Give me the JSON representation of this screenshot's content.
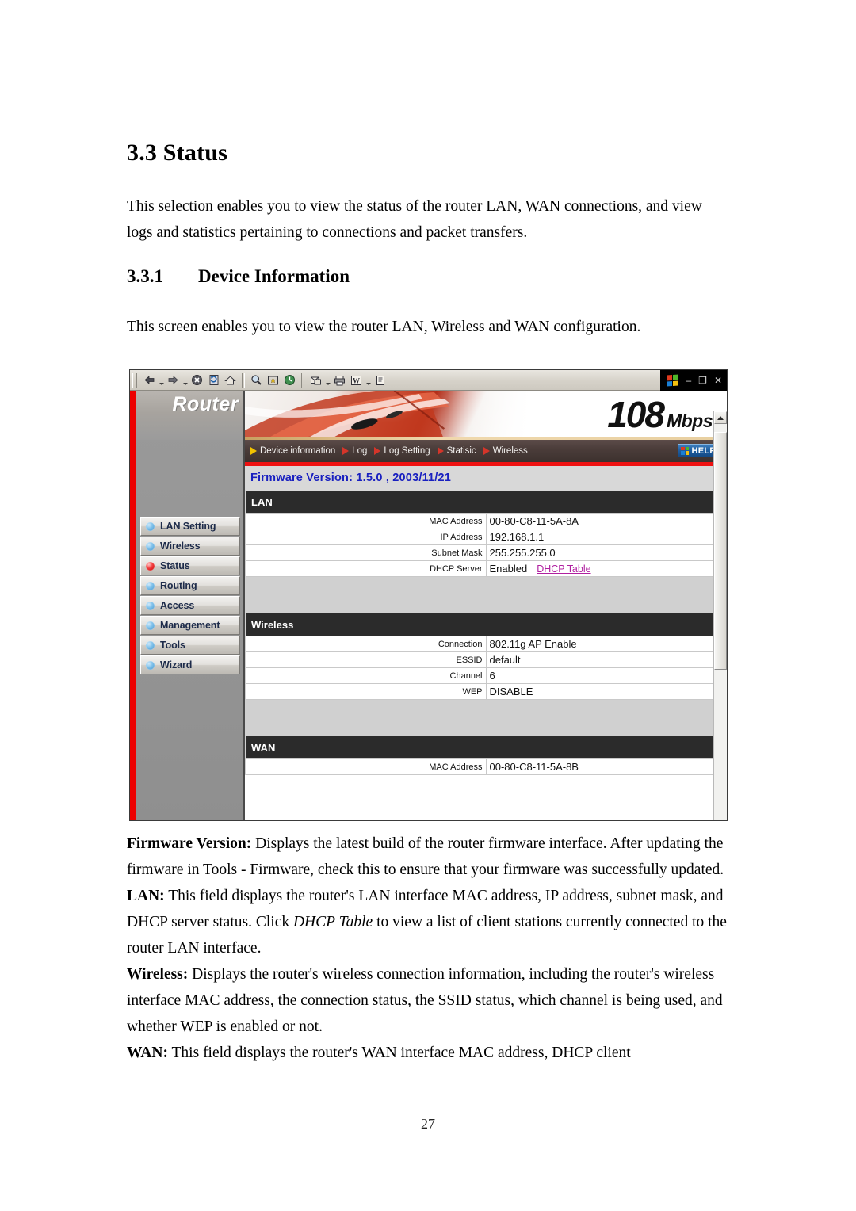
{
  "document": {
    "section_title": "3.3 Status",
    "intro_paragraph": "This selection enables you to view the status of the router LAN, WAN connections, and view logs and statistics pertaining to connections and packet transfers.",
    "subsection_number": "3.3.1",
    "subsection_title": "Device Information",
    "screen_intro": "This screen enables you to view the router LAN, Wireless and WAN configuration.",
    "page_number": "27",
    "descriptions": [
      {
        "label": "Firmware Version:",
        "text": " Displays the latest build of the router firmware interface. After updating the firmware in Tools - Firmware, check this to ensure that your firmware was successfully updated."
      },
      {
        "label": "LAN:",
        "text_before": " This field displays the router's LAN interface MAC address, IP address, subnet mask, and DHCP server status. Click ",
        "italic": "DHCP Table",
        "text_after": " to view a list of client stations currently connected to the router LAN interface."
      },
      {
        "label": "Wireless:",
        "text": " Displays the router's wireless connection information, including the router's wireless interface MAC address, the connection status, the SSID status, which channel is being used, and whether WEP is enabled or not."
      },
      {
        "label": "WAN:",
        "text": " This field displays the router's WAN interface MAC address, DHCP client"
      }
    ]
  },
  "browser": {
    "toolbar": {
      "buttons": [
        {
          "name": "back-button",
          "glyph": "⇐"
        },
        {
          "name": "forward-button",
          "glyph": "⇒"
        },
        {
          "name": "stop-button",
          "glyph": "⊗"
        },
        {
          "name": "refresh-button",
          "glyph": "↻"
        },
        {
          "name": "home-button",
          "glyph": "⌂"
        },
        {
          "name": "search-button",
          "glyph": "⌕"
        },
        {
          "name": "favorites-button",
          "glyph": "★"
        },
        {
          "name": "history-button",
          "glyph": "◔"
        },
        {
          "name": "mail-button",
          "glyph": "✉"
        },
        {
          "name": "print-button",
          "glyph": "⎙"
        },
        {
          "name": "edit-button",
          "glyph": "W"
        },
        {
          "name": "discuss-button",
          "glyph": "☰"
        }
      ]
    },
    "window_controls": {
      "minimize": "–",
      "restore": "❐",
      "close": "✕"
    }
  },
  "router_ui": {
    "logo": "Router",
    "banner": {
      "speed": "108",
      "unit": "Mbps"
    },
    "nav_items": [
      {
        "label": "Device information",
        "active": true
      },
      {
        "label": "Log",
        "active": false
      },
      {
        "label": "Log Setting",
        "active": false
      },
      {
        "label": "Statisic",
        "active": false
      },
      {
        "label": "Wireless",
        "active": false
      }
    ],
    "help_button": "HELP",
    "firmware_line": "Firmware Version: 1.5.0 , 2003/11/21",
    "sidebar_items": [
      {
        "label": "LAN Setting",
        "active": false
      },
      {
        "label": "Wireless",
        "active": false
      },
      {
        "label": "Status",
        "active": true
      },
      {
        "label": "Routing",
        "active": false
      },
      {
        "label": "Access",
        "active": false
      },
      {
        "label": "Management",
        "active": false
      },
      {
        "label": "Tools",
        "active": false
      },
      {
        "label": "Wizard",
        "active": false
      }
    ],
    "tables": {
      "lan": {
        "title": "LAN",
        "rows": [
          {
            "key": "MAC Address",
            "value": "00-80-C8-11-5A-8A"
          },
          {
            "key": "IP Address",
            "value": "192.168.1.1"
          },
          {
            "key": "Subnet Mask",
            "value": "255.255.255.0"
          },
          {
            "key": "DHCP Server",
            "value": "Enabled",
            "link": "DHCP Table"
          }
        ]
      },
      "wireless": {
        "title": "Wireless",
        "rows": [
          {
            "key": "Connection",
            "value": "802.11g AP Enable"
          },
          {
            "key": "ESSID",
            "value": "default"
          },
          {
            "key": "Channel",
            "value": "6"
          },
          {
            "key": "WEP",
            "value": "DISABLE"
          }
        ]
      },
      "wan": {
        "title": "WAN",
        "rows": [
          {
            "key": "MAC Address",
            "value": "00-80-C8-11-5A-8B"
          }
        ]
      }
    }
  },
  "colors": {
    "accent_red": "#ed0000",
    "firmware_blue": "#1920c0",
    "link_magenta": "#b020a0",
    "nav_bar": "#3c312e",
    "table_header": "#2b2b2b"
  }
}
